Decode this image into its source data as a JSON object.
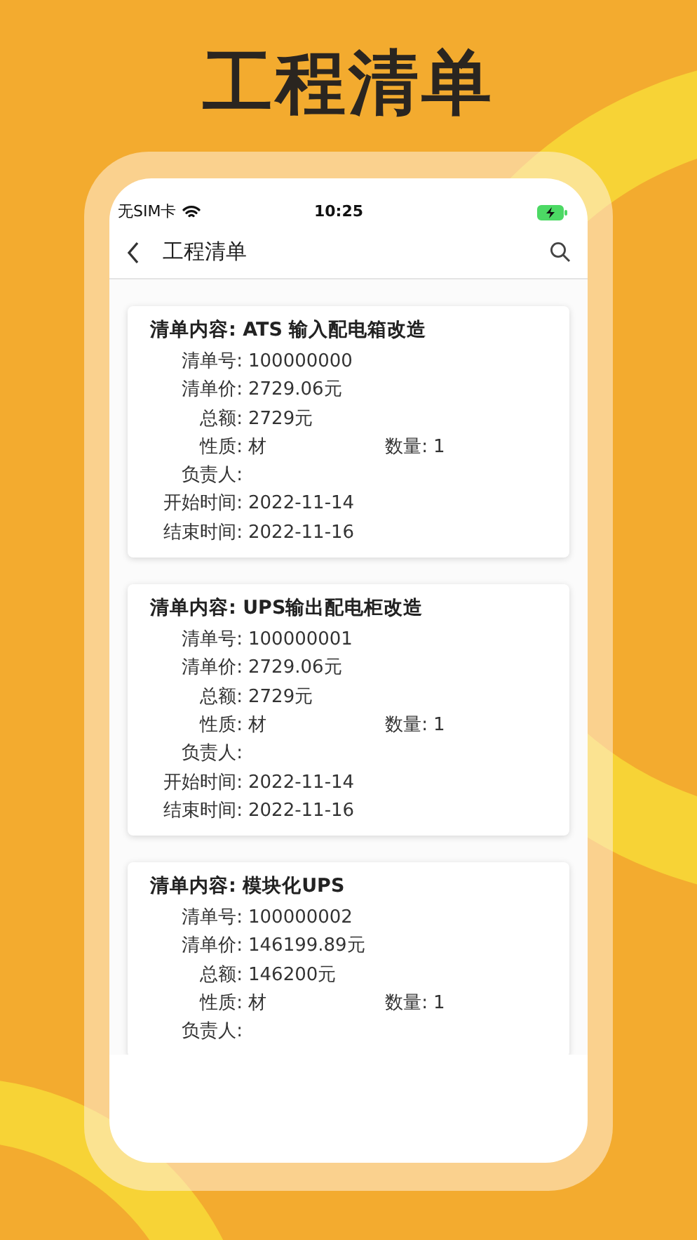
{
  "headline": "工程清单",
  "status_bar": {
    "carrier": "无SIM卡",
    "time": "10:25"
  },
  "nav": {
    "title": "工程清单"
  },
  "items": [
    {
      "title_label": "清单内容:",
      "title": "ATS 输入配电箱改造",
      "rows": [
        {
          "label": "清单号:",
          "value": "100000000"
        },
        {
          "label": "清单价:",
          "value": "2729.06元"
        },
        {
          "label": "总额:",
          "value": "2729元"
        },
        {
          "label": "性质:",
          "value": "材",
          "label2": "数量:",
          "value2": "1"
        },
        {
          "label": "负责人:",
          "value": ""
        },
        {
          "label": "开始时间:",
          "value": "2022-11-14"
        },
        {
          "label": "结束时间:",
          "value": "2022-11-16"
        }
      ]
    },
    {
      "title_label": "清单内容:",
      "title": "UPS输出配电柜改造",
      "rows": [
        {
          "label": "清单号:",
          "value": "100000001"
        },
        {
          "label": "清单价:",
          "value": "2729.06元"
        },
        {
          "label": "总额:",
          "value": "2729元"
        },
        {
          "label": "性质:",
          "value": "材",
          "label2": "数量:",
          "value2": "1"
        },
        {
          "label": "负责人:",
          "value": ""
        },
        {
          "label": "开始时间:",
          "value": "2022-11-14"
        },
        {
          "label": "结束时间:",
          "value": "2022-11-16"
        }
      ]
    },
    {
      "title_label": "清单内容:",
      "title": "模块化UPS",
      "rows": [
        {
          "label": "清单号:",
          "value": "100000002"
        },
        {
          "label": "清单价:",
          "value": "146199.89元"
        },
        {
          "label": "总额:",
          "value": "146200元"
        },
        {
          "label": "性质:",
          "value": "材",
          "label2": "数量:",
          "value2": "1"
        },
        {
          "label": "负责人:",
          "value": ""
        }
      ]
    }
  ]
}
